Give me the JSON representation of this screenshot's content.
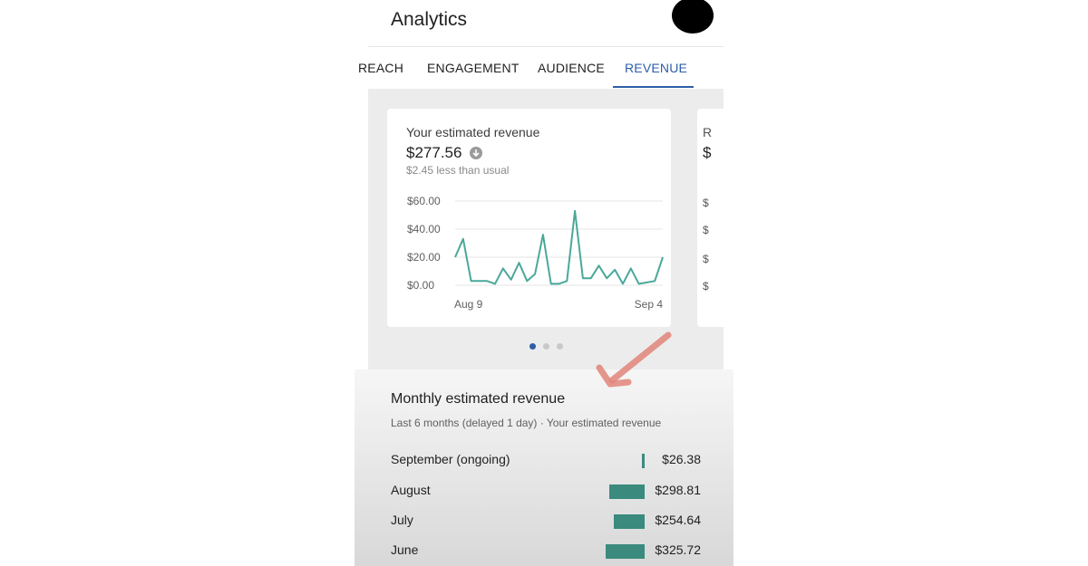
{
  "header": {
    "title": "Analytics"
  },
  "tabs": [
    {
      "label": "REACH"
    },
    {
      "label": "ENGAGEMENT"
    },
    {
      "label": "AUDIENCE"
    },
    {
      "label": "REVENUE",
      "active": true
    }
  ],
  "card": {
    "title": "Your estimated revenue",
    "value": "$277.56",
    "delta": "$2.45 less than usual",
    "status_icon": "arrow-down-circle-icon"
  },
  "card_peek": {
    "title_fragment": "R",
    "value_fragment": "$",
    "tick_fragment": "$"
  },
  "chart_data": {
    "type": "line",
    "y_ticks": [
      "$60.00",
      "$40.00",
      "$20.00",
      "$0.00"
    ],
    "x_ticks": [
      "Aug 9",
      "Sep 4"
    ],
    "ylim": [
      0,
      60
    ],
    "grid": true,
    "color": "#4aa89a",
    "values": [
      20,
      33,
      3,
      3,
      3,
      1,
      12,
      4,
      16,
      3,
      8,
      36,
      1,
      1,
      3,
      53,
      5,
      5,
      14,
      5,
      11,
      1,
      12,
      1,
      2,
      3,
      20
    ]
  },
  "pager": {
    "count": 3,
    "active": 0
  },
  "monthly": {
    "title": "Monthly estimated revenue",
    "subtitle": "Last 6 months (delayed 1 day) · Your estimated revenue",
    "rows": [
      {
        "label": "September (ongoing)",
        "value": "$26.38",
        "amount": 26.38
      },
      {
        "label": "August",
        "value": "$298.81",
        "amount": 298.81
      },
      {
        "label": "July",
        "value": "$254.64",
        "amount": 254.64
      },
      {
        "label": "June",
        "value": "$325.72",
        "amount": 325.72
      }
    ],
    "bar_color": "#3a8a7d"
  }
}
